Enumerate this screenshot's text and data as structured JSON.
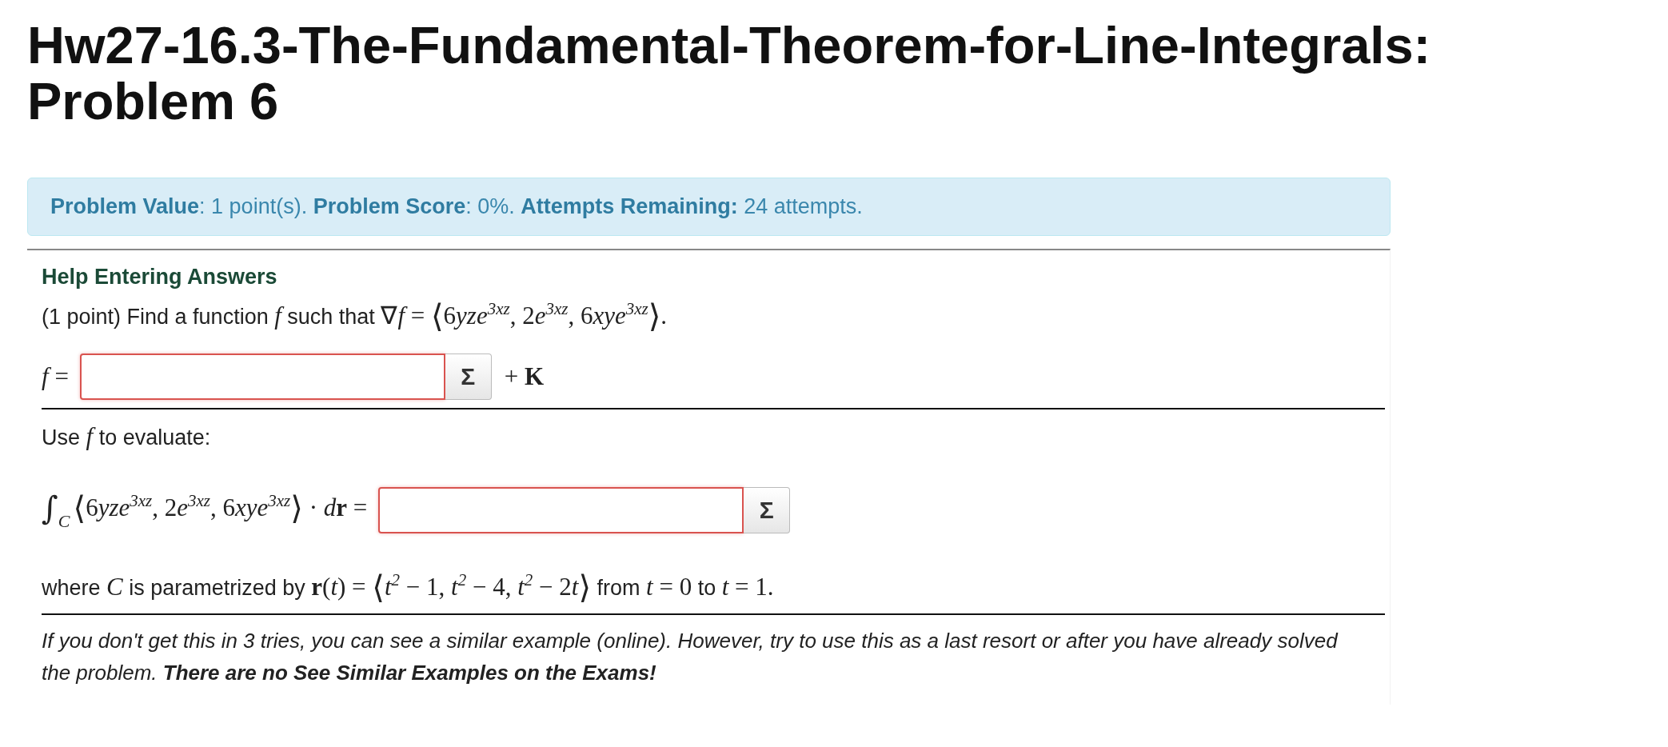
{
  "title": "Hw27-16.3-The-Fundamental-Theorem-for-Line-Integrals: Problem 6",
  "info": "**Problem Value**: 1 point(s). **Problem Score**: 0%. **Attempts Remaining:** 24 attempts.",
  "help_link": "Help Entering Answers",
  "question": [
    {
      "kind": "text",
      "s": "(1 point) Find a function "
    },
    {
      "kind": "var",
      "s": "f"
    },
    {
      "kind": "text",
      "s": " such that "
    },
    {
      "kind": "math",
      "s": "∇"
    },
    {
      "kind": "var",
      "s": "f"
    },
    {
      "kind": "math",
      "s": " = "
    },
    {
      "kind": "big",
      "s": "⟨"
    },
    {
      "kind": "math",
      "s": "6"
    },
    {
      "kind": "var",
      "s": "yze"
    },
    {
      "kind": "sup",
      "s": "3xz"
    },
    {
      "kind": "math",
      "s": ", 2"
    },
    {
      "kind": "var",
      "s": "e"
    },
    {
      "kind": "sup",
      "s": "3xz"
    },
    {
      "kind": "math",
      "s": ", 6"
    },
    {
      "kind": "var",
      "s": "xye"
    },
    {
      "kind": "sup",
      "s": "3xz"
    },
    {
      "kind": "big",
      "s": "⟩"
    },
    {
      "kind": "math",
      "s": "."
    }
  ],
  "answer_1": {
    "before": [
      {
        "kind": "var",
        "s": "f"
      },
      {
        "kind": "math",
        "s": " ="
      }
    ],
    "sigma": "Σ",
    "after": [
      {
        "kind": "math",
        "s": "+ "
      },
      {
        "kind": "bold",
        "s": "K"
      }
    ]
  },
  "use_line": [
    {
      "kind": "text",
      "s": "Use "
    },
    {
      "kind": "var",
      "s": "f"
    },
    {
      "kind": "text",
      "s": " to evaluate:"
    }
  ],
  "answer_2": {
    "before": [
      {
        "kind": "big",
        "s": "∫"
      },
      {
        "kind": "sub",
        "s": "C"
      },
      {
        "kind": "big",
        "s": "⟨"
      },
      {
        "kind": "math",
        "s": "6"
      },
      {
        "kind": "var",
        "s": "yze"
      },
      {
        "kind": "sup",
        "s": "3xz"
      },
      {
        "kind": "math",
        "s": ", 2"
      },
      {
        "kind": "var",
        "s": "e"
      },
      {
        "kind": "sup",
        "s": "3xz"
      },
      {
        "kind": "math",
        "s": ", 6"
      },
      {
        "kind": "var",
        "s": "xye"
      },
      {
        "kind": "sup",
        "s": "3xz"
      },
      {
        "kind": "big",
        "s": "⟩"
      },
      {
        "kind": "math",
        "s": " · "
      },
      {
        "kind": "var",
        "s": "d"
      },
      {
        "kind": "bold",
        "s": "r"
      },
      {
        "kind": "math",
        "s": " ="
      }
    ],
    "sigma": "Σ"
  },
  "where_line": [
    {
      "kind": "text",
      "s": "where "
    },
    {
      "kind": "var",
      "s": "C"
    },
    {
      "kind": "text",
      "s": " is parametrized by "
    },
    {
      "kind": "bold",
      "s": "r"
    },
    {
      "kind": "math",
      "s": "("
    },
    {
      "kind": "var",
      "s": "t"
    },
    {
      "kind": "math",
      "s": ") = "
    },
    {
      "kind": "big",
      "s": "⟨"
    },
    {
      "kind": "var",
      "s": "t"
    },
    {
      "kind": "sup",
      "s": "2"
    },
    {
      "kind": "math",
      "s": " − 1, "
    },
    {
      "kind": "var",
      "s": "t"
    },
    {
      "kind": "sup",
      "s": "2"
    },
    {
      "kind": "math",
      "s": " − 4, "
    },
    {
      "kind": "var",
      "s": "t"
    },
    {
      "kind": "sup",
      "s": "2"
    },
    {
      "kind": "math",
      "s": " − 2"
    },
    {
      "kind": "var",
      "s": "t"
    },
    {
      "kind": "big",
      "s": "⟩"
    },
    {
      "kind": "text",
      "s": " from "
    },
    {
      "kind": "var",
      "s": "t"
    },
    {
      "kind": "math",
      "s": " = 0"
    },
    {
      "kind": "text",
      "s": " to "
    },
    {
      "kind": "var",
      "s": "t"
    },
    {
      "kind": "math",
      "s": " = 1."
    }
  ],
  "footer": "If you don't get this in 3 tries, you can see a similar example (online). However, try to use this as a last resort or after you have already solved the problem. **There are no See Similar Examples on the Exams!**"
}
